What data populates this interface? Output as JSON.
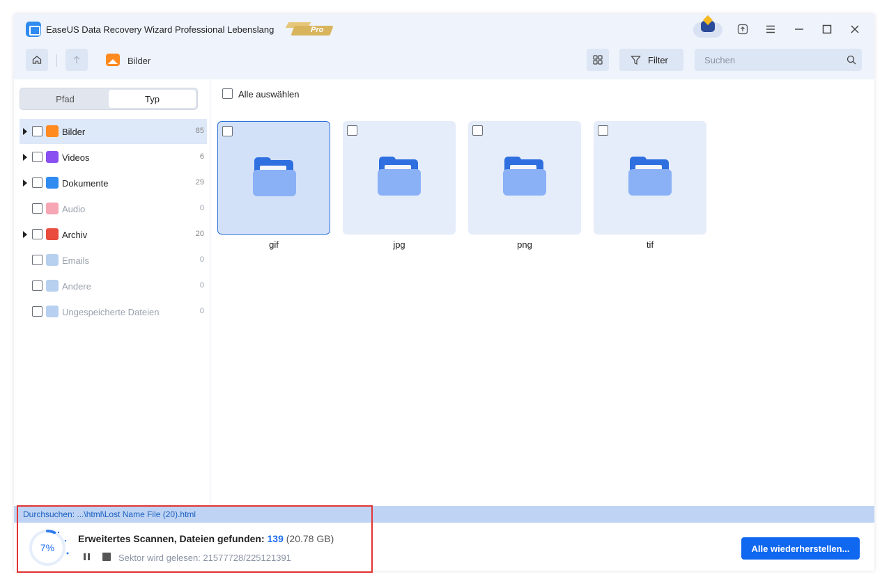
{
  "app": {
    "title": "EaseUS Data Recovery Wizard Professional Lebenslang",
    "pro_badge": "Pro"
  },
  "toolbar": {
    "breadcrumb": "Bilder",
    "filter_label": "Filter",
    "search_placeholder": "Suchen"
  },
  "sidebar": {
    "tabs": [
      {
        "label": "Pfad",
        "active": false
      },
      {
        "label": "Typ",
        "active": true
      }
    ],
    "categories": [
      {
        "label": "Bilder",
        "count": "85",
        "icon": "image-icon",
        "color": "#ff8a1f",
        "expandable": true,
        "selected": true
      },
      {
        "label": "Videos",
        "count": "6",
        "icon": "video-icon",
        "color": "#8a4ff0",
        "expandable": true,
        "selected": false
      },
      {
        "label": "Dokumente",
        "count": "29",
        "icon": "document-icon",
        "color": "#2f8bf0",
        "expandable": true,
        "selected": false
      },
      {
        "label": "Audio",
        "count": "0",
        "icon": "music-icon",
        "color": "#f7a6b4",
        "expandable": false,
        "selected": false
      },
      {
        "label": "Archiv",
        "count": "20",
        "icon": "archive-icon",
        "color": "#e94b3c",
        "expandable": true,
        "selected": false
      },
      {
        "label": "Emails",
        "count": "0",
        "icon": "email-icon",
        "color": "#b8d0f0",
        "expandable": false,
        "selected": false
      },
      {
        "label": "Andere",
        "count": "0",
        "icon": "other-folder-icon",
        "color": "#b8d0f0",
        "expandable": false,
        "selected": false
      },
      {
        "label": "Ungespeicherte Dateien",
        "count": "0",
        "icon": "unsaved-folder-icon",
        "color": "#b8d0f0",
        "expandable": false,
        "selected": false
      }
    ]
  },
  "content": {
    "select_all": "Alle auswählen",
    "folders": [
      {
        "label": "gif",
        "selected": true
      },
      {
        "label": "jpg",
        "selected": false
      },
      {
        "label": "png",
        "selected": false
      },
      {
        "label": "tif",
        "selected": false
      }
    ]
  },
  "status": {
    "path_line": "Durchsuchen: ...\\html\\Lost Name File (20).html",
    "progress_percent": 7,
    "progress_label": "7%",
    "scan_label": "Erweitertes Scannen, Dateien gefunden:",
    "files_found": "139",
    "total_size": "(20.78 GB)",
    "sector_text": "Sektor wird gelesen: 21577728/225121391",
    "recover_button": "Alle wiederherstellen..."
  },
  "colors": {
    "accent": "#1068f0",
    "titlebar_bg": "#eef3fc",
    "highlight_border": "#e33333"
  }
}
